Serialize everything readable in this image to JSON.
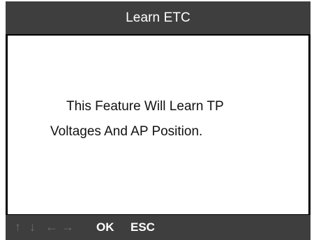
{
  "screen": {
    "title": "Learn ETC"
  },
  "message": {
    "line1": "This Feature Will Learn TP",
    "line2": "Voltages And AP Position."
  },
  "footer": {
    "arrows": {
      "up": "↑",
      "down": "↓",
      "left": "←",
      "right": "→"
    },
    "ok_label": "OK",
    "esc_label": "ESC"
  },
  "icons": {
    "up": "arrow-up-icon",
    "down": "arrow-down-icon",
    "left": "arrow-left-icon",
    "right": "arrow-right-icon"
  },
  "colors": {
    "bar_background": "#3e3e3e",
    "content_background": "#ffffff",
    "text": "#111111",
    "arrow_inactive": "#6b6b6b"
  }
}
